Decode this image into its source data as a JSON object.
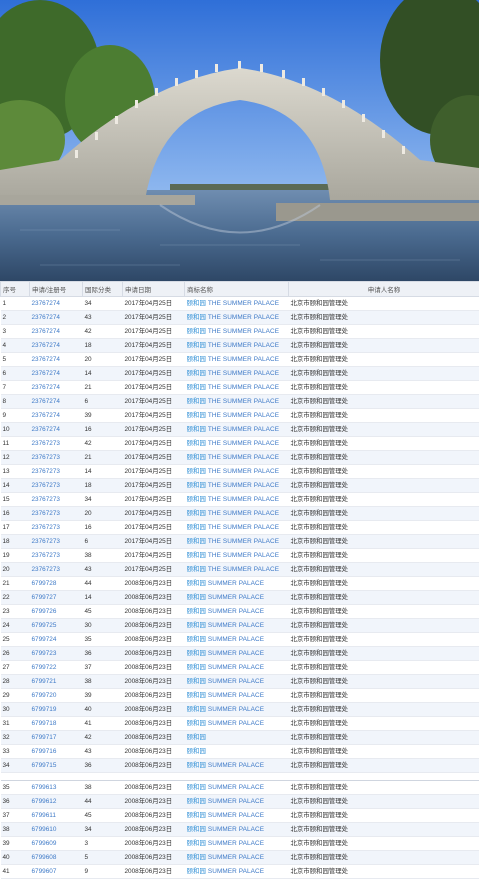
{
  "table": {
    "headers": [
      "序号",
      "申请/注册号",
      "国际分类",
      "申请日期",
      "商标名称",
      "申请人名称"
    ],
    "rows": [
      {
        "no": "1",
        "reg": "23767274",
        "cls": "34",
        "date": "2017年04月25日",
        "cn": "颐和园",
        "en": "THE SUMMER PALACE",
        "app": "北京市颐和园管理处"
      },
      {
        "no": "2",
        "reg": "23767274",
        "cls": "43",
        "date": "2017年04月25日",
        "cn": "颐和园",
        "en": "THE SUMMER PALACE",
        "app": "北京市颐和园管理处"
      },
      {
        "no": "3",
        "reg": "23767274",
        "cls": "42",
        "date": "2017年04月25日",
        "cn": "颐和园",
        "en": "THE SUMMER PALACE",
        "app": "北京市颐和园管理处"
      },
      {
        "no": "4",
        "reg": "23767274",
        "cls": "18",
        "date": "2017年04月25日",
        "cn": "颐和园",
        "en": "THE SUMMER PALACE",
        "app": "北京市颐和园管理处"
      },
      {
        "no": "5",
        "reg": "23767274",
        "cls": "20",
        "date": "2017年04月25日",
        "cn": "颐和园",
        "en": "THE SUMMER PALACE",
        "app": "北京市颐和园管理处"
      },
      {
        "no": "6",
        "reg": "23767274",
        "cls": "14",
        "date": "2017年04月25日",
        "cn": "颐和园",
        "en": "THE SUMMER PALACE",
        "app": "北京市颐和园管理处"
      },
      {
        "no": "7",
        "reg": "23767274",
        "cls": "21",
        "date": "2017年04月25日",
        "cn": "颐和园",
        "en": "THE SUMMER PALACE",
        "app": "北京市颐和园管理处"
      },
      {
        "no": "8",
        "reg": "23767274",
        "cls": "6",
        "date": "2017年04月25日",
        "cn": "颐和园",
        "en": "THE SUMMER PALACE",
        "app": "北京市颐和园管理处"
      },
      {
        "no": "9",
        "reg": "23767274",
        "cls": "39",
        "date": "2017年04月25日",
        "cn": "颐和园",
        "en": "THE SUMMER PALACE",
        "app": "北京市颐和园管理处"
      },
      {
        "no": "10",
        "reg": "23767274",
        "cls": "16",
        "date": "2017年04月25日",
        "cn": "颐和园",
        "en": "THE SUMMER PALACE",
        "app": "北京市颐和园管理处"
      },
      {
        "no": "11",
        "reg": "23767273",
        "cls": "42",
        "date": "2017年04月25日",
        "cn": "颐和园",
        "en": "THE SUMMER PALACE",
        "app": "北京市颐和园管理处"
      },
      {
        "no": "12",
        "reg": "23767273",
        "cls": "21",
        "date": "2017年04月25日",
        "cn": "颐和园",
        "en": "THE SUMMER PALACE",
        "app": "北京市颐和园管理处"
      },
      {
        "no": "13",
        "reg": "23767273",
        "cls": "14",
        "date": "2017年04月25日",
        "cn": "颐和园",
        "en": "THE SUMMER PALACE",
        "app": "北京市颐和园管理处"
      },
      {
        "no": "14",
        "reg": "23767273",
        "cls": "18",
        "date": "2017年04月25日",
        "cn": "颐和园",
        "en": "THE SUMMER PALACE",
        "app": "北京市颐和园管理处"
      },
      {
        "no": "15",
        "reg": "23767273",
        "cls": "34",
        "date": "2017年04月25日",
        "cn": "颐和园",
        "en": "THE SUMMER PALACE",
        "app": "北京市颐和园管理处"
      },
      {
        "no": "16",
        "reg": "23767273",
        "cls": "20",
        "date": "2017年04月25日",
        "cn": "颐和园",
        "en": "THE SUMMER PALACE",
        "app": "北京市颐和园管理处"
      },
      {
        "no": "17",
        "reg": "23767273",
        "cls": "16",
        "date": "2017年04月25日",
        "cn": "颐和园",
        "en": "THE SUMMER PALACE",
        "app": "北京市颐和园管理处"
      },
      {
        "no": "18",
        "reg": "23767273",
        "cls": "6",
        "date": "2017年04月25日",
        "cn": "颐和园",
        "en": "THE SUMMER PALACE",
        "app": "北京市颐和园管理处"
      },
      {
        "no": "19",
        "reg": "23767273",
        "cls": "38",
        "date": "2017年04月25日",
        "cn": "颐和园",
        "en": "THE SUMMER PALACE",
        "app": "北京市颐和园管理处"
      },
      {
        "no": "20",
        "reg": "23767273",
        "cls": "43",
        "date": "2017年04月25日",
        "cn": "颐和园",
        "en": "THE SUMMER PALACE",
        "app": "北京市颐和园管理处"
      },
      {
        "no": "21",
        "reg": "6799728",
        "cls": "44",
        "date": "2008年06月23日",
        "cn": "颐和园",
        "en": "SUMMER PALACE",
        "app": "北京市颐和园管理处"
      },
      {
        "no": "22",
        "reg": "6799727",
        "cls": "14",
        "date": "2008年06月23日",
        "cn": "颐和园",
        "en": "SUMMER PALACE",
        "app": "北京市颐和园管理处"
      },
      {
        "no": "23",
        "reg": "6799726",
        "cls": "45",
        "date": "2008年06月23日",
        "cn": "颐和园",
        "en": "SUMMER PALACE",
        "app": "北京市颐和园管理处"
      },
      {
        "no": "24",
        "reg": "6799725",
        "cls": "30",
        "date": "2008年06月23日",
        "cn": "颐和园",
        "en": "SUMMER PALACE",
        "app": "北京市颐和园管理处"
      },
      {
        "no": "25",
        "reg": "6799724",
        "cls": "35",
        "date": "2008年06月23日",
        "cn": "颐和园",
        "en": "SUMMER PALACE",
        "app": "北京市颐和园管理处"
      },
      {
        "no": "26",
        "reg": "6799723",
        "cls": "36",
        "date": "2008年06月23日",
        "cn": "颐和园",
        "en": "SUMMER PALACE",
        "app": "北京市颐和园管理处"
      },
      {
        "no": "27",
        "reg": "6799722",
        "cls": "37",
        "date": "2008年06月23日",
        "cn": "颐和园",
        "en": "SUMMER PALACE",
        "app": "北京市颐和园管理处"
      },
      {
        "no": "28",
        "reg": "6799721",
        "cls": "38",
        "date": "2008年06月23日",
        "cn": "颐和园",
        "en": "SUMMER PALACE",
        "app": "北京市颐和园管理处"
      },
      {
        "no": "29",
        "reg": "6799720",
        "cls": "39",
        "date": "2008年06月23日",
        "cn": "颐和园",
        "en": "SUMMER PALACE",
        "app": "北京市颐和园管理处"
      },
      {
        "no": "30",
        "reg": "6799719",
        "cls": "40",
        "date": "2008年06月23日",
        "cn": "颐和园",
        "en": "SUMMER PALACE",
        "app": "北京市颐和园管理处"
      },
      {
        "no": "31",
        "reg": "6799718",
        "cls": "41",
        "date": "2008年06月23日",
        "cn": "颐和园",
        "en": "SUMMER PALACE",
        "app": "北京市颐和园管理处"
      },
      {
        "no": "32",
        "reg": "6799717",
        "cls": "42",
        "date": "2008年06月23日",
        "cn": "颐和园",
        "en": "",
        "app": "北京市颐和园管理处"
      },
      {
        "no": "33",
        "reg": "6799716",
        "cls": "43",
        "date": "2008年06月23日",
        "cn": "颐和园",
        "en": "",
        "app": "北京市颐和园管理处"
      },
      {
        "no": "34",
        "reg": "6799715",
        "cls": "36",
        "date": "2008年06月23日",
        "cn": "颐和园",
        "en": "SUMMER PALACE",
        "app": "北京市颐和园管理处"
      }
    ],
    "rows2": [
      {
        "no": "35",
        "reg": "6799613",
        "cls": "38",
        "date": "2008年06月23日",
        "cn": "颐和园",
        "en": "SUMMER PALACE",
        "app": "北京市颐和园管理处"
      },
      {
        "no": "36",
        "reg": "6799612",
        "cls": "44",
        "date": "2008年06月23日",
        "cn": "颐和园",
        "en": "SUMMER PALACE",
        "app": "北京市颐和园管理处"
      },
      {
        "no": "37",
        "reg": "6799611",
        "cls": "45",
        "date": "2008年06月23日",
        "cn": "颐和园",
        "en": "SUMMER PALACE",
        "app": "北京市颐和园管理处"
      },
      {
        "no": "38",
        "reg": "6799610",
        "cls": "34",
        "date": "2008年06月23日",
        "cn": "颐和园",
        "en": "SUMMER PALACE",
        "app": "北京市颐和园管理处"
      },
      {
        "no": "39",
        "reg": "6799609",
        "cls": "3",
        "date": "2008年06月23日",
        "cn": "颐和园",
        "en": "SUMMER PALACE",
        "app": "北京市颐和园管理处"
      },
      {
        "no": "40",
        "reg": "6799608",
        "cls": "5",
        "date": "2008年06月23日",
        "cn": "颐和园",
        "en": "SUMMER PALACE",
        "app": "北京市颐和园管理处"
      },
      {
        "no": "41",
        "reg": "6799607",
        "cls": "9",
        "date": "2008年06月23日",
        "cn": "颐和园",
        "en": "SUMMER PALACE",
        "app": "北京市颐和园管理处"
      }
    ]
  }
}
